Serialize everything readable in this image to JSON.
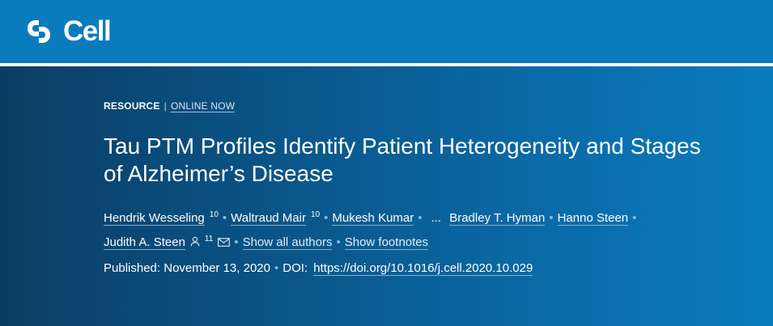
{
  "brand": {
    "name": "Cell",
    "logo_icon": "cell-press-logo-icon",
    "bar_color": "#0a7bbd"
  },
  "article": {
    "type_label": "RESOURCE",
    "separator": "|",
    "status_link": "ONLINE NOW",
    "title": "Tau PTM Profiles Identify Patient Heterogeneity and Stages of Alzheimer’s Disease",
    "authors": [
      {
        "name": "Hendrik Wesseling",
        "sup": "10"
      },
      {
        "name": "Waltraud Mair",
        "sup": "10"
      },
      {
        "name": "Mukesh Kumar",
        "sup": ""
      },
      {
        "name": "Bradley T. Hyman",
        "sup": ""
      },
      {
        "name": "Hanno Steen",
        "sup": ""
      },
      {
        "name": "Judith A. Steen",
        "sup": "11",
        "icons": [
          "person-icon",
          "mail-icon"
        ]
      }
    ],
    "ellipsis": "...",
    "show_all_authors": "Show all authors",
    "show_footnotes": "Show footnotes",
    "published_label": "Published:",
    "published_date": "November 13, 2020",
    "doi_label": "DOI:",
    "doi_url": "https://doi.org/10.1016/j.cell.2020.10.029"
  }
}
